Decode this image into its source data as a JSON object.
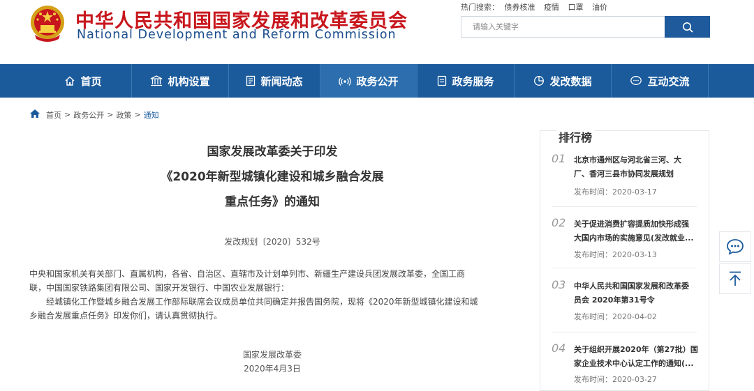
{
  "header": {
    "title_cn": "中华人民共和国国家发展和改革委员会",
    "title_en": "National Development and Reform Commission",
    "hot_label": "热门搜索：",
    "hot_items": [
      "债券核准",
      "疫情",
      "口罩",
      "油价"
    ],
    "search_placeholder": "请输入关键字"
  },
  "nav": {
    "items": [
      {
        "label": "首页",
        "icon": "home-icon"
      },
      {
        "label": "机构设置",
        "icon": "building-icon"
      },
      {
        "label": "新闻动态",
        "icon": "news-icon"
      },
      {
        "label": "政务公开",
        "icon": "broadcast-icon"
      },
      {
        "label": "政务服务",
        "icon": "document-icon"
      },
      {
        "label": "发改数据",
        "icon": "pie-chart-icon"
      },
      {
        "label": "互动交流",
        "icon": "chat-icon"
      }
    ],
    "active_index": 3
  },
  "breadcrumb": {
    "items": [
      "首页",
      "政务公开",
      "政策",
      "通知"
    ],
    "separator": ">"
  },
  "article": {
    "title_lines": [
      "国家发展改革委关于印发",
      "《2020年新型城镇化建设和城乡融合发展",
      "重点任务》的通知"
    ],
    "doc_no": "发改规划〔2020〕532号",
    "recipients_line1": "中央和国家机关有关部门、直属机构，各省、自治区、直辖市及计划单列市、新疆生产建设兵团发展改革委，全国工商",
    "recipients_line2": "联，中国国家铁路集团有限公司、国家开发银行、中国农业发展银行：",
    "body_line1": "经城镇化工作暨城乡融合发展工作部际联席会议成员单位共同确定并报告国务院，现将《2020年新型城镇化建设和城",
    "body_line2": "乡融合发展重点任务》印发你们，请认真贯彻执行。",
    "signer": "国家发展改革委",
    "date": "2020年4月3日"
  },
  "ranking": {
    "title": "排行榜",
    "date_prefix": "发布时间：",
    "items": [
      {
        "num": "01",
        "line1": "北京市通州区与河北省三河、大",
        "line2": "厂、香河三县市协同发展规划",
        "date": "2020-03-17"
      },
      {
        "num": "02",
        "line1": "关于促进消费扩容提质加快形成强",
        "line2": "大国内市场的实施意见(发改就业...",
        "date": "2020-03-13"
      },
      {
        "num": "03",
        "line1": "中华人民共和国国家发展和改革委",
        "line2": "员会 2020年第31号令",
        "date": "2020-04-02"
      },
      {
        "num": "04",
        "line1": "关于组织开展2020年（第27批）国",
        "line2": "家企业技术中心认定工作的通知(...",
        "date": "2020-03-27"
      }
    ]
  },
  "colors": {
    "brand_red": "#c8161d",
    "brand_blue": "#1b5b9c",
    "nav_active": "#2c6eae"
  }
}
